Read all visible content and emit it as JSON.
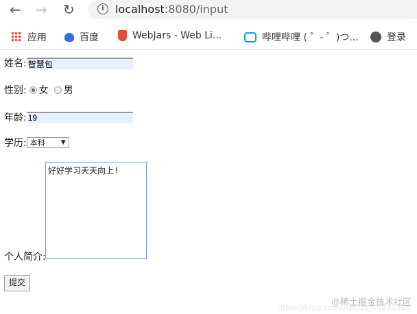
{
  "browser": {
    "url_host": "localhost",
    "url_rest": ":8080/input"
  },
  "bookmarks": [
    {
      "label": "应用",
      "icon": "apps-grid-icon"
    },
    {
      "label": "百度",
      "icon": "baidu-paw-icon"
    },
    {
      "label": "WebJars - Web Li...",
      "icon": "webjars-icon"
    },
    {
      "label": "哔哩哔哩 ( ゜- ゜)つ...",
      "icon": "bilibili-icon"
    },
    {
      "label": "登录",
      "icon": "globe-icon"
    }
  ],
  "form": {
    "name_label": "姓名:",
    "name_value": "智慧包",
    "gender_label": "性别:",
    "gender_female": "女",
    "gender_male": "男",
    "gender_selected": "女",
    "age_label": "年龄:",
    "age_value": "19",
    "edu_label": "学历:",
    "edu_value": "本科",
    "intro_label": "个人简介:",
    "intro_value": "好好学习天天向上!",
    "submit": "提交"
  },
  "watermark": {
    "main": "@稀土掘金技术社区",
    "faint": "https://blog.csdn.net/qq_44042316"
  }
}
